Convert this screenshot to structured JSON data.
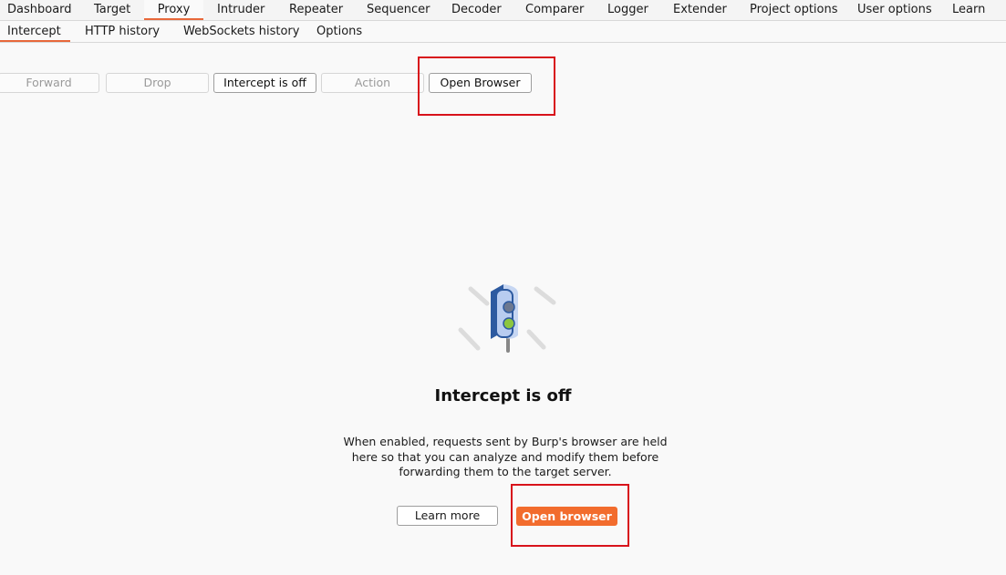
{
  "main_tabs": [
    {
      "label": "Dashboard"
    },
    {
      "label": "Target"
    },
    {
      "label": "Proxy"
    },
    {
      "label": "Intruder"
    },
    {
      "label": "Repeater"
    },
    {
      "label": "Sequencer"
    },
    {
      "label": "Decoder"
    },
    {
      "label": "Comparer"
    },
    {
      "label": "Logger"
    },
    {
      "label": "Extender"
    },
    {
      "label": "Project options"
    },
    {
      "label": "User options"
    },
    {
      "label": "Learn"
    }
  ],
  "active_main_tab": "Proxy",
  "sub_tabs": [
    {
      "label": "Intercept"
    },
    {
      "label": "HTTP history"
    },
    {
      "label": "WebSockets history"
    },
    {
      "label": "Options"
    }
  ],
  "active_sub_tab": "Intercept",
  "toolbar": {
    "forward_label": "Forward",
    "drop_label": "Drop",
    "intercept_toggle_label": "Intercept is off",
    "action_label": "Action",
    "open_browser_label": "Open Browser"
  },
  "empty_state": {
    "title": "Intercept is off",
    "description": "When enabled, requests sent by Burp's browser are held here so that you can analyze and modify them before forwarding them to the target server.",
    "learn_more_label": "Learn more",
    "open_browser_label": "Open browser",
    "illustration_icon": "traffic-light-icon"
  },
  "colors": {
    "accent": "#e8683a",
    "primary_button": "#f26c2d",
    "highlight_box": "#d8121b"
  }
}
